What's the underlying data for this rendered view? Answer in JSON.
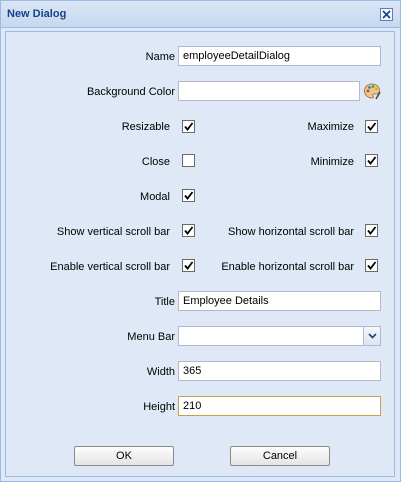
{
  "dialog": {
    "title": "New Dialog"
  },
  "fields": {
    "name_label": "Name",
    "name_value": "employeeDetailDialog",
    "bgcolor_label": "Background Color",
    "bgcolor_value": "",
    "resizable_label": "Resizable",
    "resizable_checked": true,
    "maximize_label": "Maximize",
    "maximize_checked": true,
    "close_label": "Close",
    "close_checked": false,
    "minimize_label": "Minimize",
    "minimize_checked": true,
    "modal_label": "Modal",
    "modal_checked": true,
    "show_vscroll_label": "Show vertical scroll bar",
    "show_vscroll_checked": true,
    "show_hscroll_label": "Show horizontal scroll bar",
    "show_hscroll_checked": true,
    "enable_vscroll_label": "Enable vertical scroll bar",
    "enable_vscroll_checked": true,
    "enable_hscroll_label": "Enable horizontal scroll bar",
    "enable_hscroll_checked": true,
    "title_label": "Title",
    "title_value": "Employee Details",
    "menubar_label": "Menu Bar",
    "menubar_value": "",
    "width_label": "Width",
    "width_value": "365",
    "height_label": "Height",
    "height_value": "210"
  },
  "buttons": {
    "ok_label": "OK",
    "cancel_label": "Cancel"
  },
  "icons": {
    "close": "close-icon",
    "palette": "palette-icon",
    "combo": "chevron-down-icon",
    "check": "checkmark-icon"
  },
  "colors": {
    "title_text": "#15428b",
    "panel_bg": "#dfe8f6",
    "border": "#99bbe8"
  }
}
